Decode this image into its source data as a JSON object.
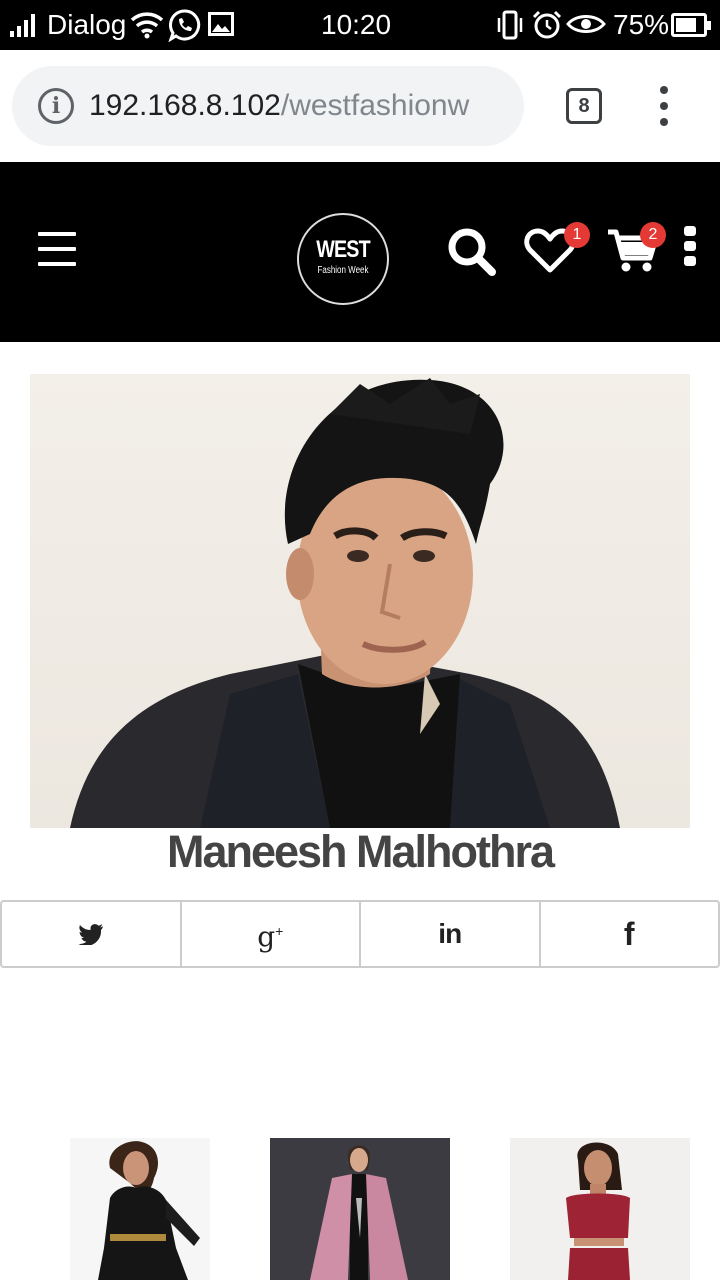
{
  "status_bar": {
    "carrier": "Dialog",
    "time": "10:20",
    "battery_percent": "75%",
    "battery_level": 0.75,
    "icons": [
      "signal-icon",
      "wifi-icon",
      "whatsapp-icon",
      "gallery-icon",
      "vibrate-icon",
      "alarm-icon",
      "eye-icon",
      "battery-icon"
    ]
  },
  "browser": {
    "url_host": "192.168.8.102",
    "url_path": "/westfashionw",
    "tab_count": "8",
    "icons": [
      "info-icon",
      "tabs-icon",
      "more-icon"
    ]
  },
  "header": {
    "logo_line1": "WEST",
    "logo_line2": "Fashion Week",
    "wishlist_count": "1",
    "cart_count": "2",
    "icons": [
      "menu-icon",
      "search-icon",
      "heart-icon",
      "cart-icon",
      "more-icon"
    ],
    "colors": {
      "background": "#000000",
      "badge": "#e53935"
    }
  },
  "designer": {
    "name": "Maneesh Malhothra"
  },
  "share": {
    "icons": [
      "twitter-icon",
      "google-plus-icon",
      "linkedin-icon",
      "facebook-icon"
    ],
    "gplus_glyph": "g",
    "gplus_sup": "+",
    "linkedin_glyph": "in",
    "facebook_glyph": "f"
  },
  "products": [
    {
      "image": "woman-black-dress"
    },
    {
      "image": "woman-pink-coat"
    },
    {
      "image": "woman-red-crop-top"
    }
  ]
}
